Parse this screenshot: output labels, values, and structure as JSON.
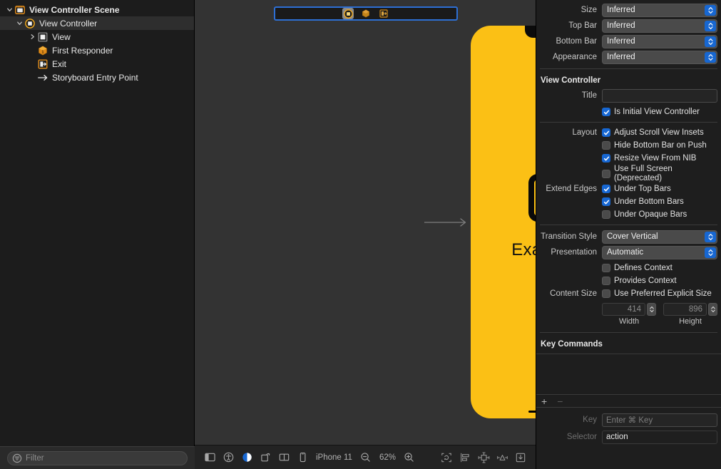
{
  "outline": {
    "items": [
      {
        "label": "View Controller Scene",
        "icon": "scene-icon",
        "depth": 0,
        "twist": "down",
        "bold": true,
        "selected": false
      },
      {
        "label": "View Controller",
        "icon": "view-controller-icon",
        "depth": 1,
        "twist": "down",
        "bold": false,
        "selected": true
      },
      {
        "label": "View",
        "icon": "view-icon",
        "depth": 2,
        "twist": "right",
        "bold": false,
        "selected": false
      },
      {
        "label": "First Responder",
        "icon": "first-responder-icon",
        "depth": 2,
        "twist": "none",
        "bold": false,
        "selected": false
      },
      {
        "label": "Exit",
        "icon": "exit-icon",
        "depth": 2,
        "twist": "none",
        "bold": false,
        "selected": false
      },
      {
        "label": "Storyboard Entry Point",
        "icon": "entry-point-arrow-icon",
        "depth": 2,
        "twist": "none",
        "bold": false,
        "selected": false
      }
    ],
    "filter": {
      "placeholder": "Filter",
      "value": "",
      "icon": "filter-icon"
    }
  },
  "canvas": {
    "scene_dock": {
      "icons": [
        "view-controller-dock-icon",
        "first-responder-dock-icon",
        "exit-dock-icon"
      ],
      "selected_index": 0
    },
    "entry_arrow": "storyboard-entry-arrow",
    "view_controller": {
      "background_color": "#FBC015",
      "placeholder_icon": "photo-placeholder-icon",
      "label": "Example VC"
    },
    "toolbar": {
      "device": "iPhone 11",
      "zoom": "62%",
      "buttons": [
        "show-document-outline-icon",
        "accessibility-inspector-icon",
        "appearance-variations-icon",
        "adaptation-icon",
        "split-view-icon",
        "device-orientation-icon"
      ],
      "zoom_out_icon": "zoom-out-icon",
      "zoom_in_icon": "zoom-in-icon",
      "right_buttons": [
        "update-frames-icon",
        "align-icon",
        "add-constraints-icon",
        "resolve-auto-layout-icon",
        "embed-in-icon"
      ]
    }
  },
  "inspector": {
    "simulated_metrics": [
      {
        "label": "Size",
        "value": "Inferred"
      },
      {
        "label": "Top Bar",
        "value": "Inferred"
      },
      {
        "label": "Bottom Bar",
        "value": "Inferred"
      },
      {
        "label": "Appearance",
        "value": "Inferred"
      }
    ],
    "view_controller": {
      "section_title": "View Controller",
      "title": {
        "label": "Title",
        "value": "",
        "placeholder": ""
      },
      "is_initial": {
        "label": "Is Initial View Controller",
        "checked": true
      },
      "layout_label": "Layout",
      "layout": [
        {
          "label": "Adjust Scroll View Insets",
          "checked": true
        },
        {
          "label": "Hide Bottom Bar on Push",
          "checked": false
        },
        {
          "label": "Resize View From NIB",
          "checked": true
        },
        {
          "label": "Use Full Screen (Deprecated)",
          "checked": false
        }
      ],
      "extend_edges_label": "Extend Edges",
      "extend_edges": [
        {
          "label": "Under Top Bars",
          "checked": true
        },
        {
          "label": "Under Bottom Bars",
          "checked": true
        },
        {
          "label": "Under Opaque Bars",
          "checked": false
        }
      ],
      "transition_style": {
        "label": "Transition Style",
        "value": "Cover Vertical"
      },
      "presentation": {
        "label": "Presentation",
        "value": "Automatic"
      },
      "context": [
        {
          "label": "Defines Context",
          "checked": false
        },
        {
          "label": "Provides Context",
          "checked": false
        }
      ],
      "content_size_label": "Content Size",
      "use_preferred_explicit_size": {
        "label": "Use Preferred Explicit Size",
        "checked": false
      },
      "width": {
        "value": "414",
        "caption": "Width"
      },
      "height": {
        "value": "896",
        "caption": "Height"
      }
    },
    "key_commands": {
      "section_title": "Key Commands",
      "add_label": "+",
      "remove_label": "−",
      "key": {
        "label": "Key",
        "placeholder": "Enter ⌘ Key",
        "value": ""
      },
      "selector": {
        "label": "Selector",
        "value": "action"
      }
    }
  },
  "colors": {
    "accent_blue": "#1767d2",
    "vc_yellow": "#FBC015",
    "selection_border": "#2d6fd4",
    "icon_orange": "#e08b1a"
  }
}
